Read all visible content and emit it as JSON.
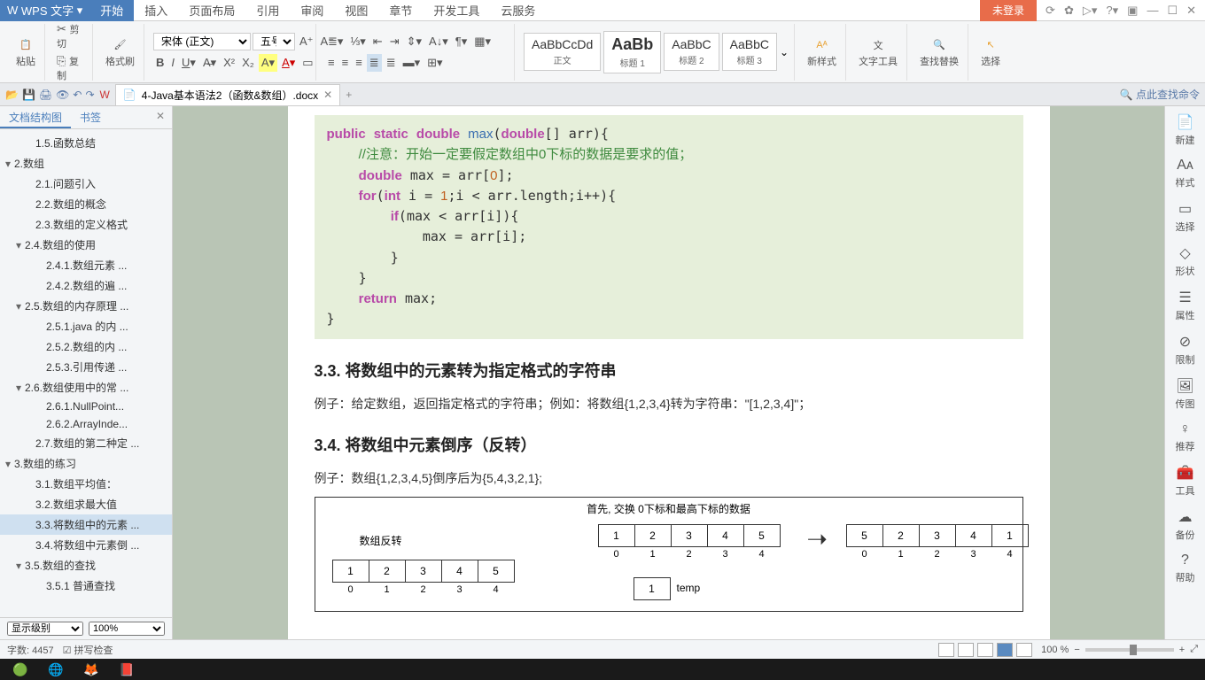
{
  "titlebar": {
    "app_name": "WPS 文字",
    "login": "未登录",
    "tabs": [
      "开始",
      "插入",
      "页面布局",
      "引用",
      "审阅",
      "视图",
      "章节",
      "开发工具",
      "云服务"
    ]
  },
  "ribbon": {
    "paste": "粘贴",
    "cut": "剪切",
    "copy": "复制",
    "format_painter": "格式刷",
    "font_name": "宋体 (正文)",
    "font_size": "五号",
    "styles": [
      {
        "preview": "AaBbCcDd",
        "label": "正文"
      },
      {
        "preview": "AaBb",
        "label": "标题 1"
      },
      {
        "preview": "AaBbC",
        "label": "标题 2"
      },
      {
        "preview": "AaBbC",
        "label": "标题 3"
      }
    ],
    "new_style": "新样式",
    "text_tools": "文字工具",
    "find_replace": "查找替换",
    "select": "选择"
  },
  "doctab": {
    "filename": "4-Java基本语法2（函数&数组）.docx",
    "search_cmd": "点此查找命令"
  },
  "navpanel": {
    "tab1": "文档结构图",
    "tab2": "书签",
    "level_label": "显示级别",
    "zoom": "100%",
    "items": [
      {
        "t": "1.5.函数总结",
        "d": 2
      },
      {
        "t": "2.数组",
        "d": 0,
        "c": "▾"
      },
      {
        "t": "2.1.问题引入",
        "d": 2
      },
      {
        "t": "2.2.数组的概念",
        "d": 2
      },
      {
        "t": "2.3.数组的定义格式",
        "d": 2
      },
      {
        "t": "2.4.数组的使用",
        "d": 1,
        "c": "▾"
      },
      {
        "t": "2.4.1.数组元素 ...",
        "d": 3
      },
      {
        "t": "2.4.2.数组的遍 ...",
        "d": 3
      },
      {
        "t": "2.5.数组的内存原理 ...",
        "d": 1,
        "c": "▾"
      },
      {
        "t": "2.5.1.java 的内 ...",
        "d": 3
      },
      {
        "t": "2.5.2.数组的内 ...",
        "d": 3
      },
      {
        "t": "2.5.3.引用传递 ...",
        "d": 3
      },
      {
        "t": "2.6.数组使用中的常 ...",
        "d": 1,
        "c": "▾"
      },
      {
        "t": "2.6.1.NullPoint...",
        "d": 3
      },
      {
        "t": "2.6.2.ArrayInde...",
        "d": 3
      },
      {
        "t": "2.7.数组的第二种定 ...",
        "d": 2
      },
      {
        "t": "3.数组的练习",
        "d": 0,
        "c": "▾"
      },
      {
        "t": "3.1.数组平均值：",
        "d": 2
      },
      {
        "t": "3.2.数组求最大值",
        "d": 2
      },
      {
        "t": "3.3.将数组中的元素 ...",
        "d": 2,
        "a": true
      },
      {
        "t": "3.4.将数组中元素倒 ...",
        "d": 2
      },
      {
        "t": "3.5.数组的查找",
        "d": 1,
        "c": "▾"
      },
      {
        "t": "3.5.1 普通查找",
        "d": 3
      }
    ]
  },
  "doc": {
    "code_lines": [
      [
        {
          "k": "kw",
          "t": "public"
        },
        {
          "t": " "
        },
        {
          "k": "kw",
          "t": "static"
        },
        {
          "t": " "
        },
        {
          "k": "type",
          "t": "double"
        },
        {
          "t": " "
        },
        {
          "k": "fn",
          "t": "max"
        },
        {
          "t": "("
        },
        {
          "k": "type",
          "t": "double"
        },
        {
          "t": "[] arr){"
        }
      ],
      [
        {
          "t": "    "
        },
        {
          "k": "cm",
          "t": "//注意：开始一定要假定数组中0下标的数据是要求的值；"
        }
      ],
      [
        {
          "t": "    "
        },
        {
          "k": "type",
          "t": "double"
        },
        {
          "t": " max = arr["
        },
        {
          "k": "num",
          "t": "0"
        },
        {
          "t": "];"
        }
      ],
      [
        {
          "t": "    "
        },
        {
          "k": "kw",
          "t": "for"
        },
        {
          "t": "("
        },
        {
          "k": "type",
          "t": "int"
        },
        {
          "t": " i = "
        },
        {
          "k": "num",
          "t": "1"
        },
        {
          "t": ";i < arr.length;i++){"
        }
      ],
      [
        {
          "t": "        "
        },
        {
          "k": "kw",
          "t": "if"
        },
        {
          "t": "(max < arr[i]){"
        }
      ],
      [
        {
          "t": "            max = arr[i];"
        }
      ],
      [
        {
          "t": "        }"
        }
      ],
      [
        {
          "t": "    }"
        }
      ],
      [
        {
          "t": "    "
        },
        {
          "k": "kw",
          "t": "return"
        },
        {
          "t": " max;"
        }
      ],
      [
        {
          "t": "}"
        }
      ]
    ],
    "h33": "3.3. 将数组中的元素转为指定格式的字符串",
    "p33": "例子：给定数组，返回指定格式的字符串；例如：将数组{1,2,3,4}转为字符串：\"[1,2,3,4]\"；",
    "h34": "3.4. 将数组中元素倒序（反转）",
    "p34": "例子：数组{1,2,3,4,5}倒序后为{5,4,3,2,1};",
    "diagram": {
      "title": "首先, 交换 0下标和最高下标的数据",
      "sub_left": "数组反转",
      "left_cells": [
        "1",
        "2",
        "3",
        "4",
        "5"
      ],
      "left_idx": [
        "0",
        "1",
        "2",
        "3",
        "4"
      ],
      "mid_cells": [
        "1",
        "2",
        "3",
        "4",
        "5"
      ],
      "mid_idx": [
        "0",
        "1",
        "2",
        "3",
        "4"
      ],
      "right_cells": [
        "5",
        "2",
        "3",
        "4",
        "1"
      ],
      "right_idx": [
        "0",
        "1",
        "2",
        "3",
        "4"
      ],
      "temp_cell": "1",
      "temp_label": "temp"
    }
  },
  "rsidebar": {
    "items": [
      {
        "ic": "📄",
        "t": "新建"
      },
      {
        "ic": "Aᴀ",
        "t": "样式"
      },
      {
        "ic": "▭",
        "t": "选择"
      },
      {
        "ic": "◇",
        "t": "形状"
      },
      {
        "ic": "☰",
        "t": "属性"
      },
      {
        "ic": "⊘",
        "t": "限制"
      },
      {
        "ic": "🖼",
        "t": "传图"
      },
      {
        "ic": "♀",
        "t": "推荐"
      },
      {
        "ic": "🧰",
        "t": "工具"
      },
      {
        "ic": "☁",
        "t": "备份"
      },
      {
        "ic": "?",
        "t": "帮助"
      }
    ]
  },
  "statusbar": {
    "wordcount": "字数: 4457",
    "spell": "拼写检查",
    "zoom": "100 %"
  }
}
